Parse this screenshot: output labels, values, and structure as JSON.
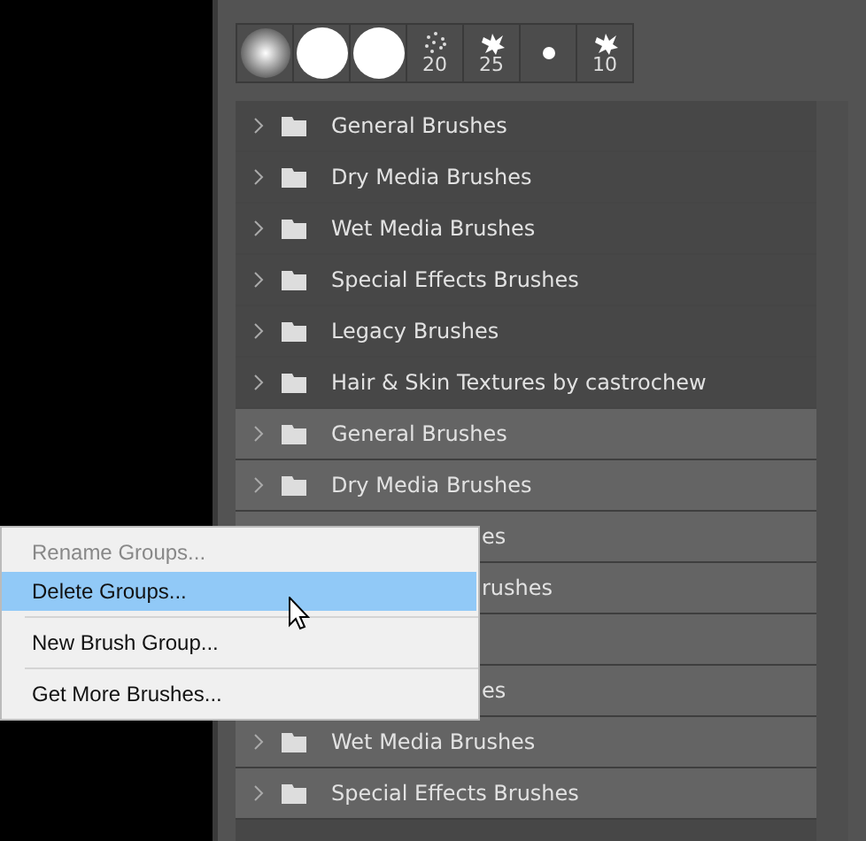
{
  "presets": [
    {
      "kind": "soft"
    },
    {
      "kind": "hard"
    },
    {
      "kind": "hard"
    },
    {
      "kind": "scatter",
      "size": "20"
    },
    {
      "kind": "splat",
      "size": "25"
    },
    {
      "kind": "dot"
    },
    {
      "kind": "splat",
      "size": "10"
    }
  ],
  "groups": [
    {
      "kind": "group",
      "label": "General Brushes",
      "selected": false
    },
    {
      "kind": "group",
      "label": "Dry Media Brushes",
      "selected": false
    },
    {
      "kind": "group",
      "label": "Wet Media Brushes",
      "selected": false
    },
    {
      "kind": "group",
      "label": "Special Effects Brushes",
      "selected": false
    },
    {
      "kind": "group",
      "label": "Legacy Brushes",
      "selected": false
    },
    {
      "kind": "group",
      "label": "Hair & Skin Textures by castrochew",
      "selected": false
    },
    {
      "kind": "group",
      "label": "General Brushes",
      "selected": true
    },
    {
      "kind": "group",
      "label": "Dry Media Brushes",
      "selected": true
    },
    {
      "kind": "covered",
      "label": "es",
      "selected": true
    },
    {
      "kind": "covered",
      "label": "rushes",
      "selected": true
    },
    {
      "kind": "covered",
      "selected": true
    },
    {
      "kind": "covered",
      "label": "es",
      "selected": true
    },
    {
      "kind": "group",
      "label": "Wet Media Brushes",
      "selected": true
    },
    {
      "kind": "group",
      "label": "Special Effects Brushes",
      "selected": true
    }
  ],
  "context_menu": {
    "items": [
      {
        "label": "Rename Groups...",
        "disabled": true,
        "selected": false
      },
      {
        "label": "Delete Groups...",
        "disabled": false,
        "selected": true
      },
      {
        "kind": "separator"
      },
      {
        "label": "New Brush Group...",
        "disabled": false,
        "selected": false
      },
      {
        "kind": "separator"
      },
      {
        "label": "Get More Brushes...",
        "disabled": false,
        "selected": false
      }
    ]
  }
}
